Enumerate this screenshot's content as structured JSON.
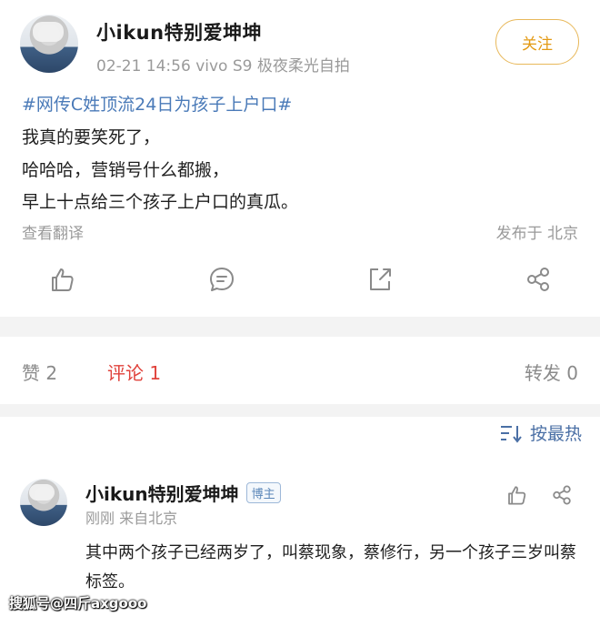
{
  "post": {
    "username": "小ikun特别爱坤坤",
    "meta": "02-21 14:56   vivo S9 极夜柔光自拍",
    "follow_label": "关注",
    "topic": "#网传C姓顶流24日为孩子上户口#",
    "lines": [
      "我真的要笑死了，",
      "哈哈哈，营销号什么都搬，",
      "早上十点给三个孩子上户口的真瓜。"
    ],
    "translate_label": "查看翻译",
    "location": "发布于 北京"
  },
  "actions": {
    "icons": [
      "like-icon",
      "comment-icon",
      "repost-icon",
      "share-icon"
    ]
  },
  "stats": {
    "likes": "赞  2",
    "comments": "评论  1",
    "reposts": "转发  0"
  },
  "sort": {
    "label": "按最热"
  },
  "comment": {
    "username": "小ikun特别爱坤坤",
    "badge": "博主",
    "meta": "刚刚  来自北京",
    "text": "其中两个孩子已经两岁了，叫蔡现象，蔡修行，另一个孩子三岁叫蔡标签。"
  },
  "watermark": "搜狐号@四斤axgooo",
  "colors": {
    "accent_link": "#4a7ab8",
    "active_tab": "#e0423b",
    "follow_border": "#e8b85a"
  }
}
